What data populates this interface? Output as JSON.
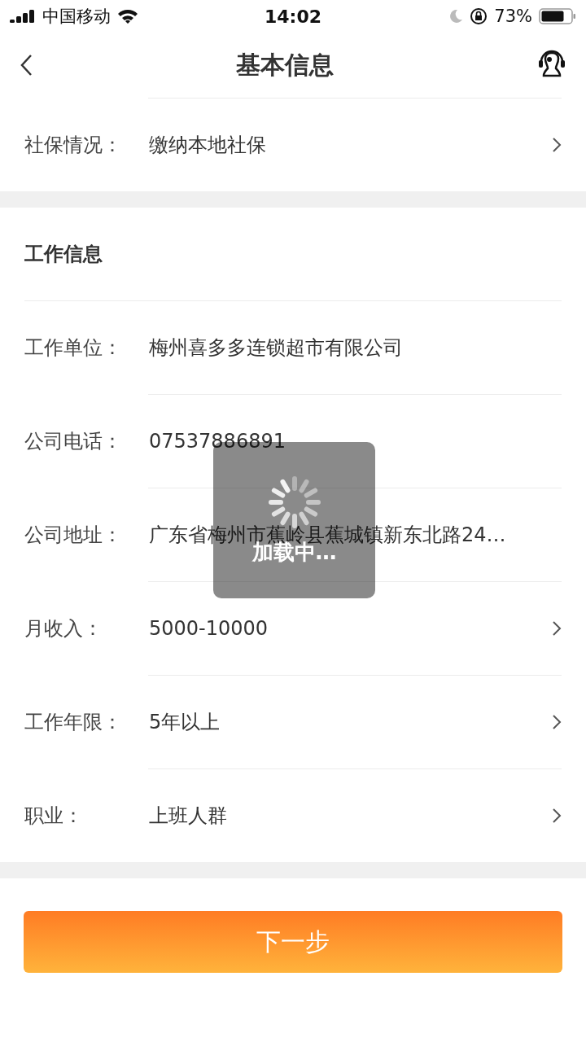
{
  "status_bar": {
    "carrier": "中国移动",
    "time": "14:02",
    "battery": "73%"
  },
  "nav": {
    "title": "基本信息"
  },
  "top_rows": [
    {
      "label": "社保情况：",
      "value": "缴纳本地社保",
      "arrow": true
    }
  ],
  "work_section": {
    "title": "工作信息",
    "rows": [
      {
        "label": "工作单位：",
        "value": "梅州喜多多连锁超市有限公司",
        "arrow": false
      },
      {
        "label": "公司电话：",
        "value": "07537886891",
        "arrow": false
      },
      {
        "label": "公司地址：",
        "value": "广东省梅州市蕉岭县蕉城镇新东北路24…",
        "arrow": false
      },
      {
        "label": "月收入：",
        "value": "5000-10000",
        "arrow": true
      },
      {
        "label": "工作年限：",
        "value": "5年以上",
        "arrow": true
      },
      {
        "label": "职业：",
        "value": "上班人群",
        "arrow": true
      }
    ]
  },
  "next_button": "下一步",
  "loading": {
    "text": "加载中…"
  }
}
